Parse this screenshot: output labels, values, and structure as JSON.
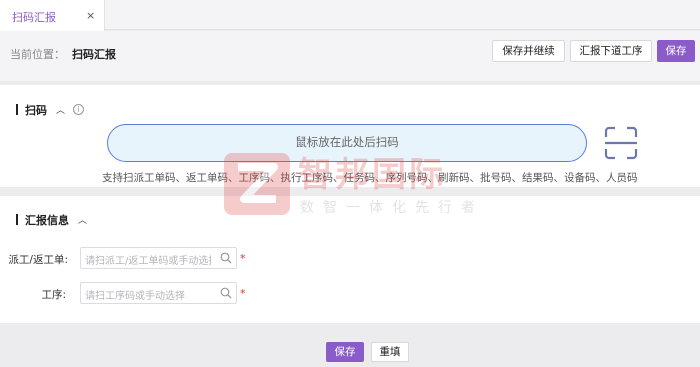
{
  "tabs": [
    {
      "label": "扫码汇报",
      "close": "×"
    }
  ],
  "topbar": {
    "location_label": "当前位置：",
    "location_value": "扫码汇报",
    "buttons": {
      "save_continue": "保存并继续",
      "report_next": "汇报下道工序",
      "save": "保存"
    }
  },
  "scan_section": {
    "title": "扫码",
    "input_text": "鼠标放在此处后扫码",
    "hint": "支持扫派工单码、返工单码、工序码、执行工序码、任务码、序列号码、刷新码、批号码、结果码、设备码、人员码"
  },
  "report_section": {
    "title": "汇报信息",
    "fields": [
      {
        "label": "派工/返工单:",
        "placeholder": "请扫派工/返工单码或手动选择",
        "required": "*"
      },
      {
        "label": "工序:",
        "placeholder": "请扫工序码或手动选择",
        "required": "*"
      }
    ]
  },
  "footer": {
    "save": "保存",
    "reset": "重填"
  },
  "watermark": {
    "title": "智邦国际",
    "subtitle": "数智一体化先行者"
  },
  "colors": {
    "accent": "#8a5cc9",
    "scan_border": "#5a7fd6",
    "scan_fill": "#e8f4fc",
    "required": "#e0303a"
  }
}
